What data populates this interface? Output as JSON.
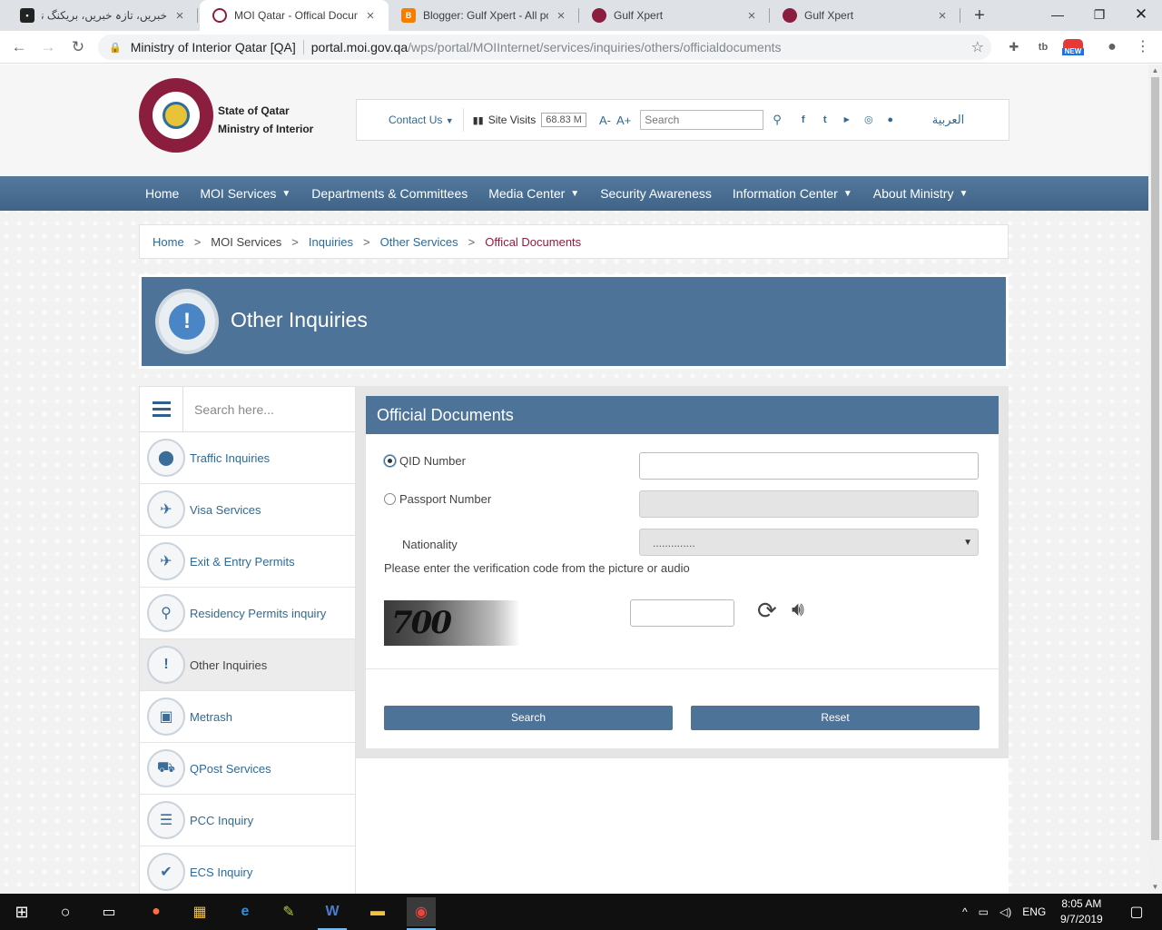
{
  "browser": {
    "tabs": [
      {
        "title": "خبریں، تازہ خبریں، بریکنگ نیو",
        "favicon": "news-favicon",
        "active": false
      },
      {
        "title": "MOI Qatar - Offical Documents",
        "favicon": "moi-favicon",
        "active": true
      },
      {
        "title": "Blogger: Gulf Xpert - All posts",
        "favicon": "blogger-favicon",
        "active": false
      },
      {
        "title": "Gulf Xpert",
        "favicon": "gulfxpert-favicon",
        "active": false
      },
      {
        "title": "Gulf Xpert",
        "favicon": "gulfxpert-favicon",
        "active": false
      }
    ],
    "address": {
      "site_name": "Ministry of Interior Qatar [QA]",
      "host": "portal.moi.gov.qa",
      "path": "/wps/portal/MOIInternet/services/inquiries/others/officialdocuments"
    },
    "extension_badge": "NEW"
  },
  "header": {
    "logo_line1": "State of Qatar",
    "logo_line2": "Ministry of Interior",
    "contact_label": "Contact Us",
    "site_visits_label": "Site Visits",
    "site_visits_count": "68.83 M",
    "font_decrease": "A-",
    "font_increase": "A+",
    "search_placeholder": "Search",
    "language_label": "العربية",
    "social_icons": [
      "facebook-icon",
      "twitter-icon",
      "youtube-icon",
      "instagram-icon",
      "snapchat-icon"
    ]
  },
  "nav": {
    "items": [
      {
        "label": "Home",
        "dropdown": false
      },
      {
        "label": "MOI Services",
        "dropdown": true
      },
      {
        "label": "Departments & Committees",
        "dropdown": false
      },
      {
        "label": "Media Center",
        "dropdown": true
      },
      {
        "label": "Security Awareness",
        "dropdown": false
      },
      {
        "label": "Information Center",
        "dropdown": true
      },
      {
        "label": "About Ministry",
        "dropdown": true
      }
    ]
  },
  "breadcrumb": [
    "Home",
    "MOI Services",
    "Inquiries",
    "Other Services",
    "Offical Documents"
  ],
  "banner": {
    "title": "Other Inquiries"
  },
  "sidebar": {
    "search_placeholder": "Search here...",
    "items": [
      {
        "label": "Traffic Inquiries",
        "icon": "traffic-light-icon"
      },
      {
        "label": "Visa Services",
        "icon": "visa-icon"
      },
      {
        "label": "Exit & Entry Permits",
        "icon": "airplane-icon"
      },
      {
        "label": "Residency Permits inquiry",
        "icon": "residency-icon"
      },
      {
        "label": "Other Inquiries",
        "icon": "exclamation-icon",
        "active": true
      },
      {
        "label": "Metrash",
        "icon": "metrash-icon"
      },
      {
        "label": "QPost Services",
        "icon": "delivery-truck-icon"
      },
      {
        "label": "PCC Inquiry",
        "icon": "certificate-icon"
      },
      {
        "label": "ECS Inquiry",
        "icon": "ecs-icon"
      }
    ]
  },
  "form": {
    "title": "Official Documents",
    "qid_label": "QID Number",
    "passport_label": "Passport Number",
    "nationality_label": "Nationality",
    "nationality_value": "..............",
    "verify_note": "Please enter the verification code from the picture or audio",
    "captcha_text": "700",
    "search_button": "Search",
    "reset_button": "Reset",
    "selected_option": "QID Number"
  },
  "taskbar": {
    "language": "ENG",
    "time": "8:05 AM",
    "date": "9/7/2019"
  },
  "colors": {
    "primary_blue": "#4e7399",
    "link_blue": "#2f6a95",
    "maroon": "#8b1e3f"
  }
}
